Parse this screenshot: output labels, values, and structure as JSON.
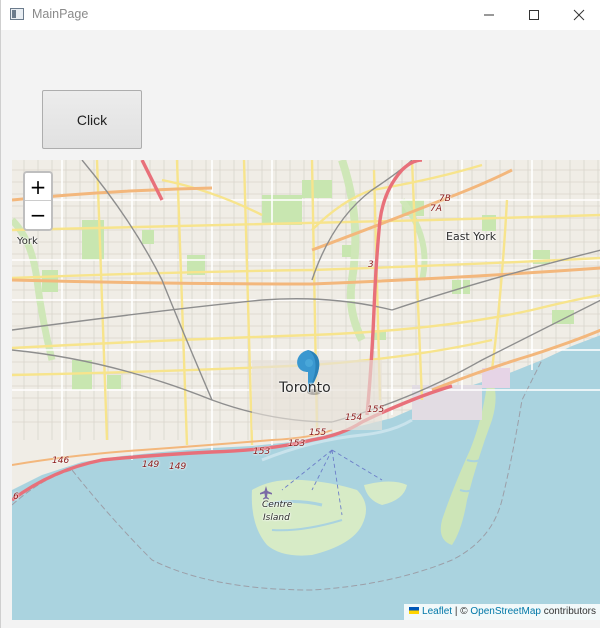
{
  "window": {
    "title": "MainPage",
    "icon": "window-app-icon",
    "controls": {
      "minimize": "minimize-icon",
      "maximize": "maximize-icon",
      "close": "close-icon"
    }
  },
  "toolbar": {
    "click_label": "Click"
  },
  "map": {
    "zoom_in_label": "+",
    "zoom_out_label": "−",
    "marker": "map-marker-icon",
    "marker_color": "#3a98d0",
    "water_color": "#aad3df",
    "place_labels": {
      "toronto": "Toronto",
      "east_york": "East York",
      "york": "York",
      "centre_island_1": "Centre",
      "centre_island_2": "Island"
    },
    "route_shields": [
      "7B",
      "7A",
      "3",
      "155",
      "154",
      "153",
      "153",
      "149",
      "149",
      "146",
      "6"
    ],
    "attribution": {
      "leaflet_label": "Leaflet",
      "separator": " | © ",
      "osm_label": "OpenStreetMap",
      "suffix": " contributors",
      "flag_icon": "ukraine-flag-icon"
    }
  }
}
